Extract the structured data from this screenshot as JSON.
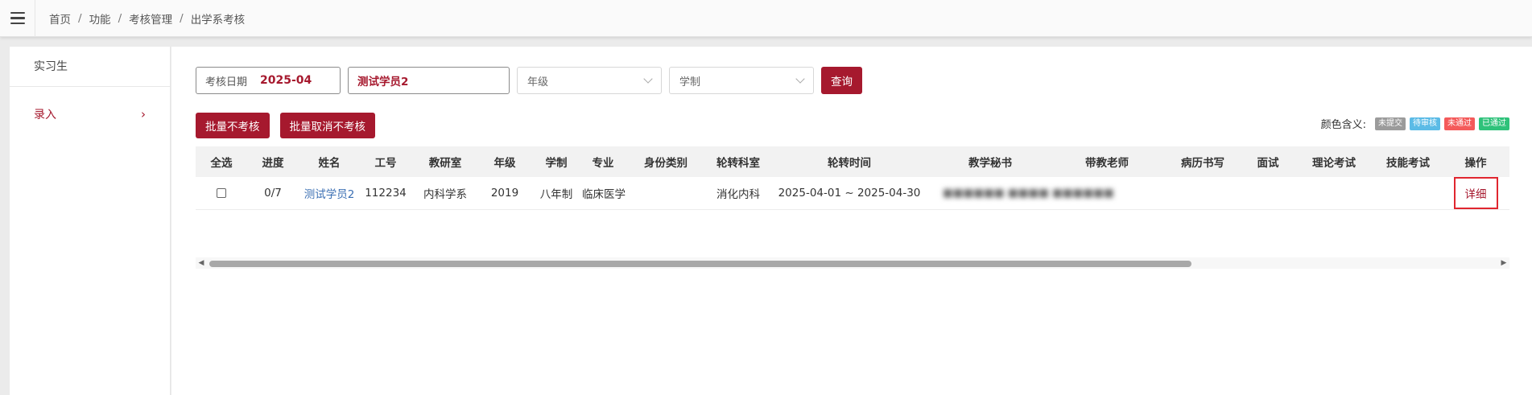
{
  "breadcrumb": [
    "首页",
    "功能",
    "考核管理",
    "出学系考核"
  ],
  "breadcrumb_sep": "/",
  "sidebar": {
    "header": "实习生",
    "items": [
      {
        "label": "录入",
        "icon": "chevron-right-icon",
        "active": true
      }
    ]
  },
  "filters": {
    "date_label": "考核日期",
    "date_value": "2025-04",
    "name_value": "测试学员2",
    "grade_placeholder": "年级",
    "system_placeholder": "学制",
    "query_label": "查询"
  },
  "batch": {
    "no_assess_label": "批量不考核",
    "cancel_no_assess_label": "批量取消不考核"
  },
  "legend": {
    "title": "颜色含义:",
    "items": [
      {
        "label": "未提交",
        "color": "#9b9b9b"
      },
      {
        "label": "待审核",
        "color": "#5bbbe6"
      },
      {
        "label": "未通过",
        "color": "#f45a5a"
      },
      {
        "label": "已通过",
        "color": "#2ec27a"
      }
    ]
  },
  "table": {
    "headers": [
      "全选",
      "进度",
      "姓名",
      "工号",
      "教研室",
      "年级",
      "学制",
      "专业",
      "身份类别",
      "轮转科室",
      "轮转时间",
      "教学秘书",
      "带教老师",
      "病历书写",
      "面试",
      "理论考试",
      "技能考试",
      "操作"
    ],
    "rows": [
      {
        "progress": "0/7",
        "name": "测试学员2",
        "id": "112234",
        "dept": "内科学系",
        "grade": "2019",
        "system": "八年制",
        "major": "临床医学",
        "identity": "",
        "rotation_dept": "消化内科",
        "rotation_time": "2025-04-01 ~ 2025-04-30",
        "secretary": "■■■■■■ ■■■■ ■■■■■■",
        "teacher": "",
        "medical_record": "",
        "interview": "",
        "theory_exam": "",
        "skill_exam": "",
        "action": "详细"
      }
    ]
  },
  "colors": {
    "accent": "#a6192e",
    "link": "#3b6fb3",
    "highlight_border": "#e0262f"
  }
}
